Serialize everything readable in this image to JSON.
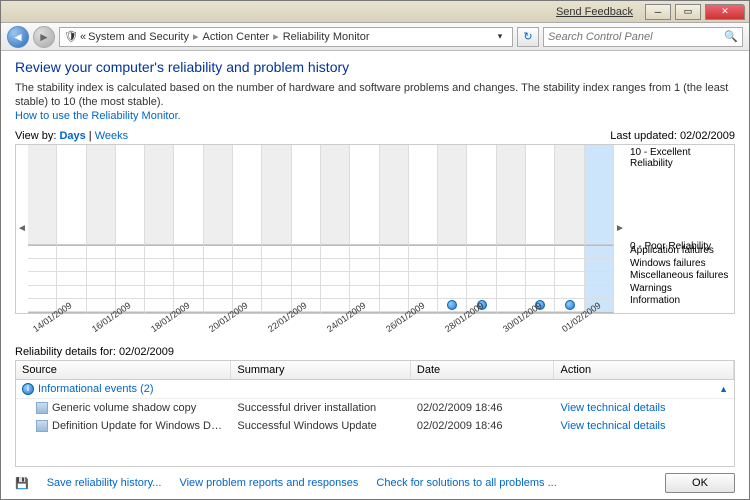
{
  "titlebar": {
    "feedback": "Send Feedback"
  },
  "nav": {
    "crumb1": "System and Security",
    "crumb2": "Action Center",
    "crumb3": "Reliability Monitor",
    "search_placeholder": "Search Control Panel"
  },
  "page": {
    "heading": "Review your computer's reliability and problem history",
    "description": "The stability index is calculated based on the number of hardware and software problems and changes. The stability index ranges from 1 (the least stable) to 10 (the most stable).",
    "how_to": "How to use the Reliability Monitor.",
    "view_by_label": "View by:",
    "view_days": "Days",
    "view_weeks": "Weeks",
    "last_updated_label": "Last updated:",
    "last_updated_value": "02/02/2009"
  },
  "chart_data": {
    "type": "reliability-timeline",
    "y_top_label": "10 - Excellent Reliability",
    "y_bottom_label": "0 - Poor Reliability",
    "categories_rows": [
      "Application failures",
      "Windows failures",
      "Miscellaneous failures",
      "Warnings",
      "Information"
    ],
    "x_dates": [
      "14/01/2009",
      "",
      "16/01/2009",
      "",
      "18/01/2009",
      "",
      "20/01/2009",
      "",
      "22/01/2009",
      "",
      "24/01/2009",
      "",
      "26/01/2009",
      "",
      "28/01/2009",
      "",
      "30/01/2009",
      "",
      "01/02/2009",
      ""
    ],
    "columns": [
      {
        "dim": true
      },
      {
        "dim": false
      },
      {
        "dim": true
      },
      {
        "dim": false
      },
      {
        "dim": true
      },
      {
        "dim": false
      },
      {
        "dim": true
      },
      {
        "dim": false
      },
      {
        "dim": true
      },
      {
        "dim": false
      },
      {
        "dim": true
      },
      {
        "dim": false
      },
      {
        "dim": true
      },
      {
        "dim": false
      },
      {
        "dim": true,
        "info": true
      },
      {
        "dim": false,
        "info": true
      },
      {
        "dim": true
      },
      {
        "dim": false,
        "info": true
      },
      {
        "dim": true,
        "info": true
      },
      {
        "dim": false,
        "selected": true
      }
    ]
  },
  "details": {
    "header_prefix": "Reliability details for:",
    "header_date": "02/02/2009",
    "columns": {
      "source": "Source",
      "summary": "Summary",
      "date": "Date",
      "action": "Action"
    },
    "group": "Informational events (2)",
    "rows": [
      {
        "source": "Generic volume shadow copy",
        "summary": "Successful driver installation",
        "date": "02/02/2009 18:46",
        "action": "View  technical details"
      },
      {
        "source": "Definition Update for Windows De...",
        "summary": "Successful Windows Update",
        "date": "02/02/2009 18:46",
        "action": "View  technical details"
      }
    ]
  },
  "footer": {
    "save": "Save reliability history...",
    "reports": "View problem reports and responses",
    "check": "Check for solutions to all problems ...",
    "ok": "OK"
  }
}
